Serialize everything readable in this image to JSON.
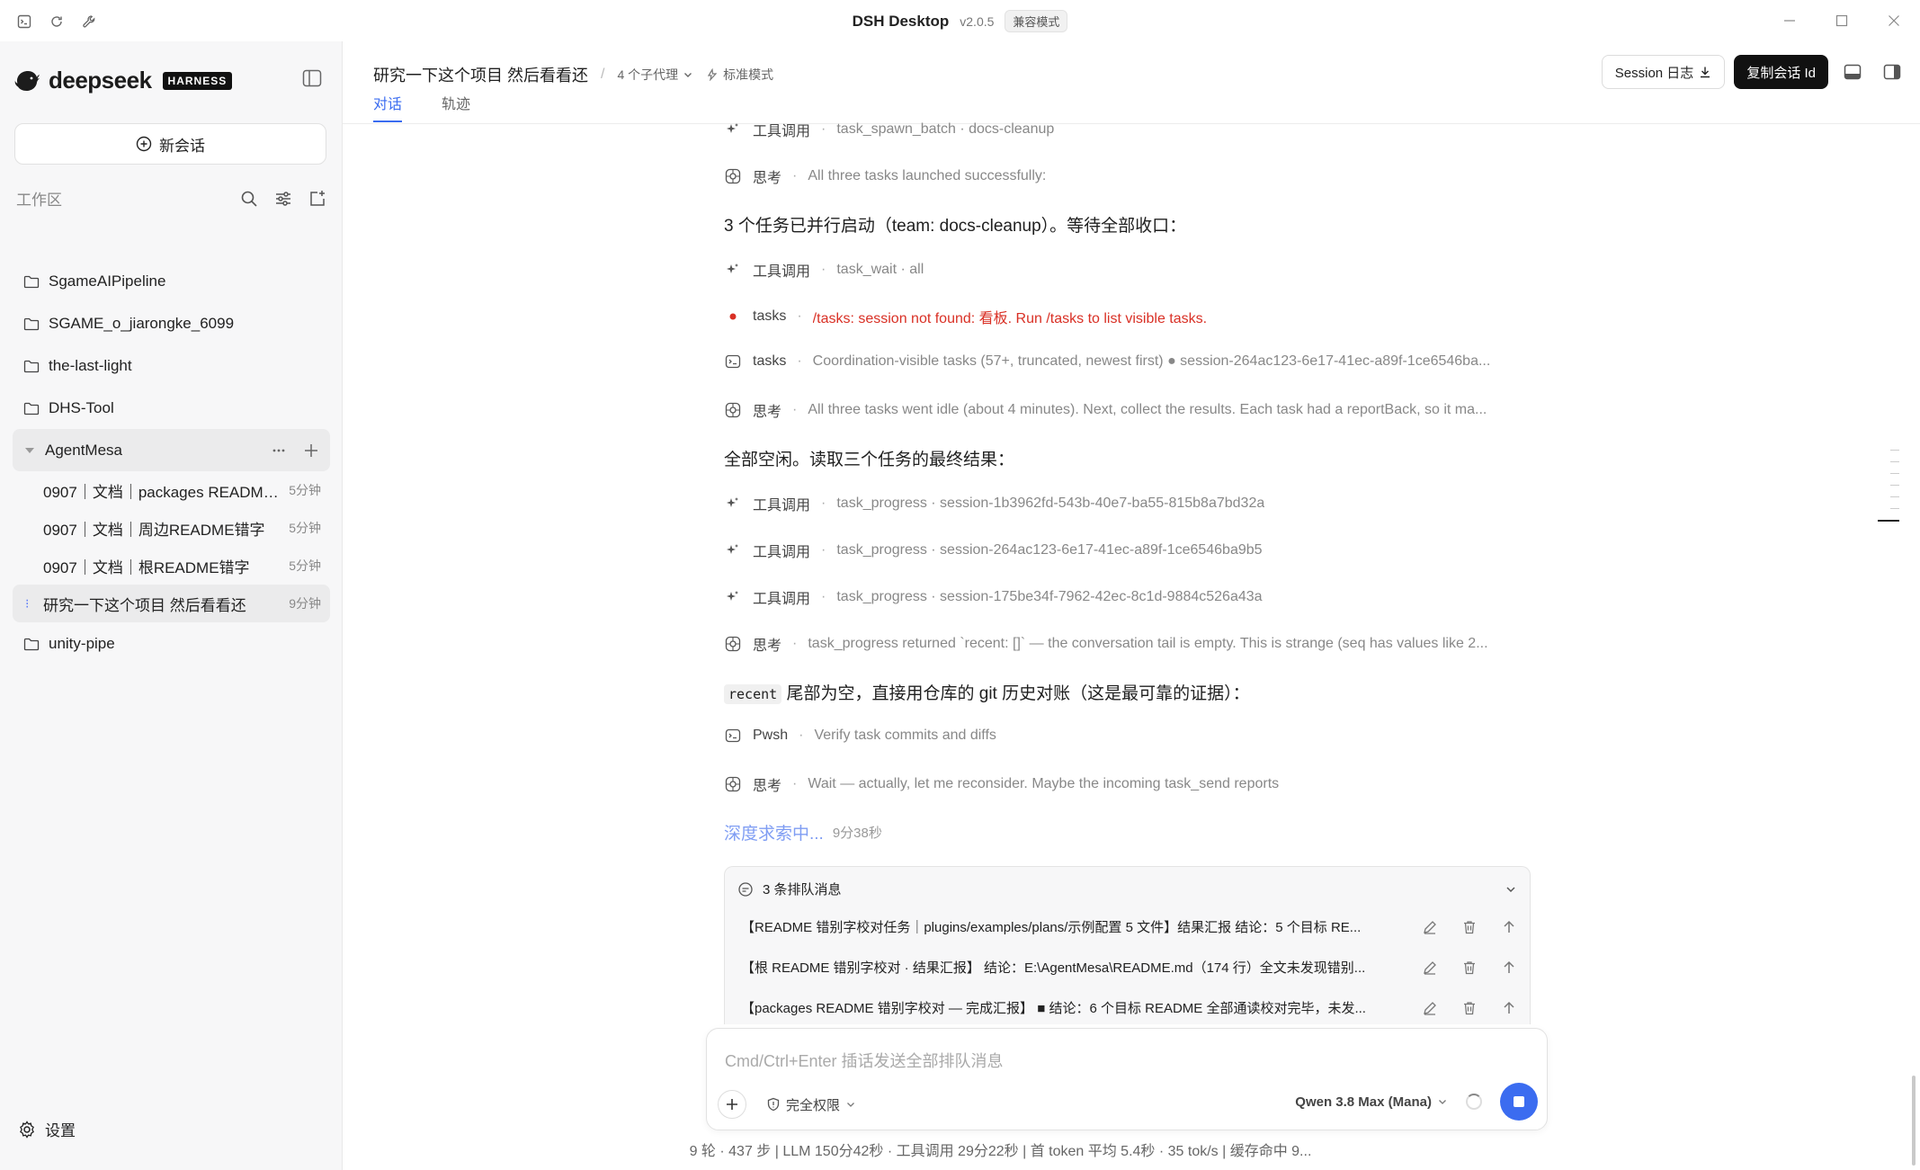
{
  "titlebar": {
    "title": "DSH Desktop",
    "version": "v2.0.5",
    "badge": "兼容模式"
  },
  "sidebar": {
    "logo_text": "deepseek",
    "logo_badge": "HARNESS",
    "new_chat": "新会话",
    "workspace_label": "工作区",
    "projects": [
      {
        "name": "SgameAIPipeline"
      },
      {
        "name": "SGAME_o_jiarongke_6099"
      },
      {
        "name": "the-last-light"
      },
      {
        "name": "DHS-Tool"
      },
      {
        "name": "AgentMesa"
      },
      {
        "name": "unity-pipe"
      }
    ],
    "sessions": [
      {
        "title": "0907｜文档｜packages README...",
        "time": "5分钟"
      },
      {
        "title": "0907｜文档｜周边README错字",
        "time": "5分钟"
      },
      {
        "title": "0907｜文档｜根README错字",
        "time": "5分钟"
      },
      {
        "title": "研究一下这个项目 然后看看还",
        "time": "9分钟"
      }
    ],
    "settings": "设置"
  },
  "header": {
    "title": "研究一下这个项目 然后看看还",
    "separator": "/",
    "agents": "4 个子代理",
    "mode": "标准模式",
    "tabs": [
      "对话",
      "轨迹"
    ],
    "session_log": "Session 日志",
    "copy_id": "复制会话 Id"
  },
  "conversation": {
    "rows": [
      {
        "kind": "tool",
        "label": "工具调用",
        "detail": "task_spawn_batch · docs-cleanup"
      },
      {
        "kind": "think",
        "label": "思考",
        "detail": "All three tasks launched successfully:"
      },
      {
        "kind": "msg",
        "text": "3 个任务已并行启动（team: docs-cleanup）。等待全部收口："
      },
      {
        "kind": "tool",
        "label": "工具调用",
        "detail": "task_wait · all"
      },
      {
        "kind": "error",
        "label": "tasks",
        "detail": "/tasks: session not found: 看板. Run /tasks to list visible tasks."
      },
      {
        "kind": "term",
        "label": "tasks",
        "detail": "Coordination-visible tasks (57+, truncated, newest first) ● session-264ac123-6e17-41ec-a89f-1ce6546ba..."
      },
      {
        "kind": "think",
        "label": "思考",
        "detail": "All three tasks went idle (about 4 minutes). Next, collect the results. Each task had a reportBack, so it ma..."
      },
      {
        "kind": "msg",
        "text": "全部空闲。读取三个任务的最终结果："
      },
      {
        "kind": "tool",
        "label": "工具调用",
        "detail": "task_progress · session-1b3962fd-543b-40e7-ba55-815b8a7bd32a"
      },
      {
        "kind": "tool",
        "label": "工具调用",
        "detail": "task_progress · session-264ac123-6e17-41ec-a89f-1ce6546ba9b5"
      },
      {
        "kind": "tool",
        "label": "工具调用",
        "detail": "task_progress · session-175be34f-7962-42ec-8c1d-9884c526a43a"
      },
      {
        "kind": "think",
        "label": "思考",
        "detail": "task_progress returned `recent: []` — the conversation tail is empty. This is strange (seq has values like 2..."
      },
      {
        "kind": "msgcode",
        "code": "recent",
        "text": "尾部为空，直接用仓库的 git 历史对账（这是最可靠的证据）："
      },
      {
        "kind": "term",
        "label": "Pwsh",
        "detail": "Verify task commits and diffs"
      },
      {
        "kind": "think",
        "label": "思考",
        "detail": "Wait — actually, let me reconsider. Maybe the incoming task_send reports"
      }
    ],
    "thinking_label": "深度求索中...",
    "thinking_time": "9分38秒"
  },
  "queue": {
    "title": "3 条排队消息",
    "items": [
      {
        "text": "【README 错别字校对任务｜plugins/examples/plans/示例配置 5 文件】结果汇报 结论：5 个目标 RE..."
      },
      {
        "text": "【根 README 错别字校对 · 结果汇报】 结论：E:\\AgentMesa\\README.md（174 行）全文未发现错别..."
      },
      {
        "text": "【packages README 错别字校对 — 完成汇报】 ■ 结论：6 个目标 README 全部通读校对完毕，未发..."
      }
    ]
  },
  "composer": {
    "placeholder": "Cmd/Ctrl+Enter 插话发送全部排队消息",
    "permission": "完全权限",
    "model": "Qwen 3.8 Max (Mana)"
  },
  "stats": "9 轮 · 437 步  |  LLM 150分42秒 · 工具调用 29分22秒  |  首 token 平均 5.4秒 · 35 tok/s  |  缓存命中 9...",
  "colors": {
    "accent": "#3b6cf0",
    "error": "#d93025",
    "thinking": "#7f9df3"
  }
}
